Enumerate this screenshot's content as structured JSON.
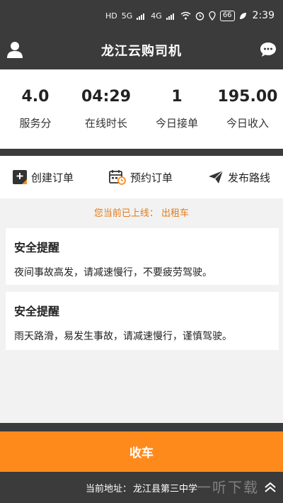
{
  "status_bar": {
    "network_hd": "HD",
    "network_5g": "5G",
    "network_4g": "4G",
    "battery": "66",
    "time": "2:39"
  },
  "header": {
    "title": "龙江云购司机",
    "left_icon": "user-icon",
    "right_icon": "chat-bubble-icon"
  },
  "stats": [
    {
      "value": "4.0",
      "label": "服务分"
    },
    {
      "value": "04:29",
      "label": "在线时长"
    },
    {
      "value": "1",
      "label": "今日接单"
    },
    {
      "value": "195.00",
      "label": "今日收入"
    }
  ],
  "actions": [
    {
      "label": "创建订单",
      "icon": "create-order-icon"
    },
    {
      "label": "预约订单",
      "icon": "calendar-clock-icon"
    },
    {
      "label": "发布路线",
      "icon": "paper-plane-icon"
    }
  ],
  "online_status": "您当前已上线： 出租车",
  "cards": [
    {
      "title": "安全提醒",
      "body": "夜间事故高发，请减速慢行，不要疲劳驾驶。"
    },
    {
      "title": "安全提醒",
      "body": "雨天路滑，易发生事故，请减速慢行，谨慎驾驶。"
    }
  ],
  "bottom": {
    "close_button": "收车",
    "address_label": "当前地址：",
    "address_value": "龙江县第三中学"
  },
  "watermark": "一听下载",
  "colors": {
    "dark": "#3b3b3b",
    "accent": "#ff8a1c",
    "online_text": "#e07b1a"
  }
}
